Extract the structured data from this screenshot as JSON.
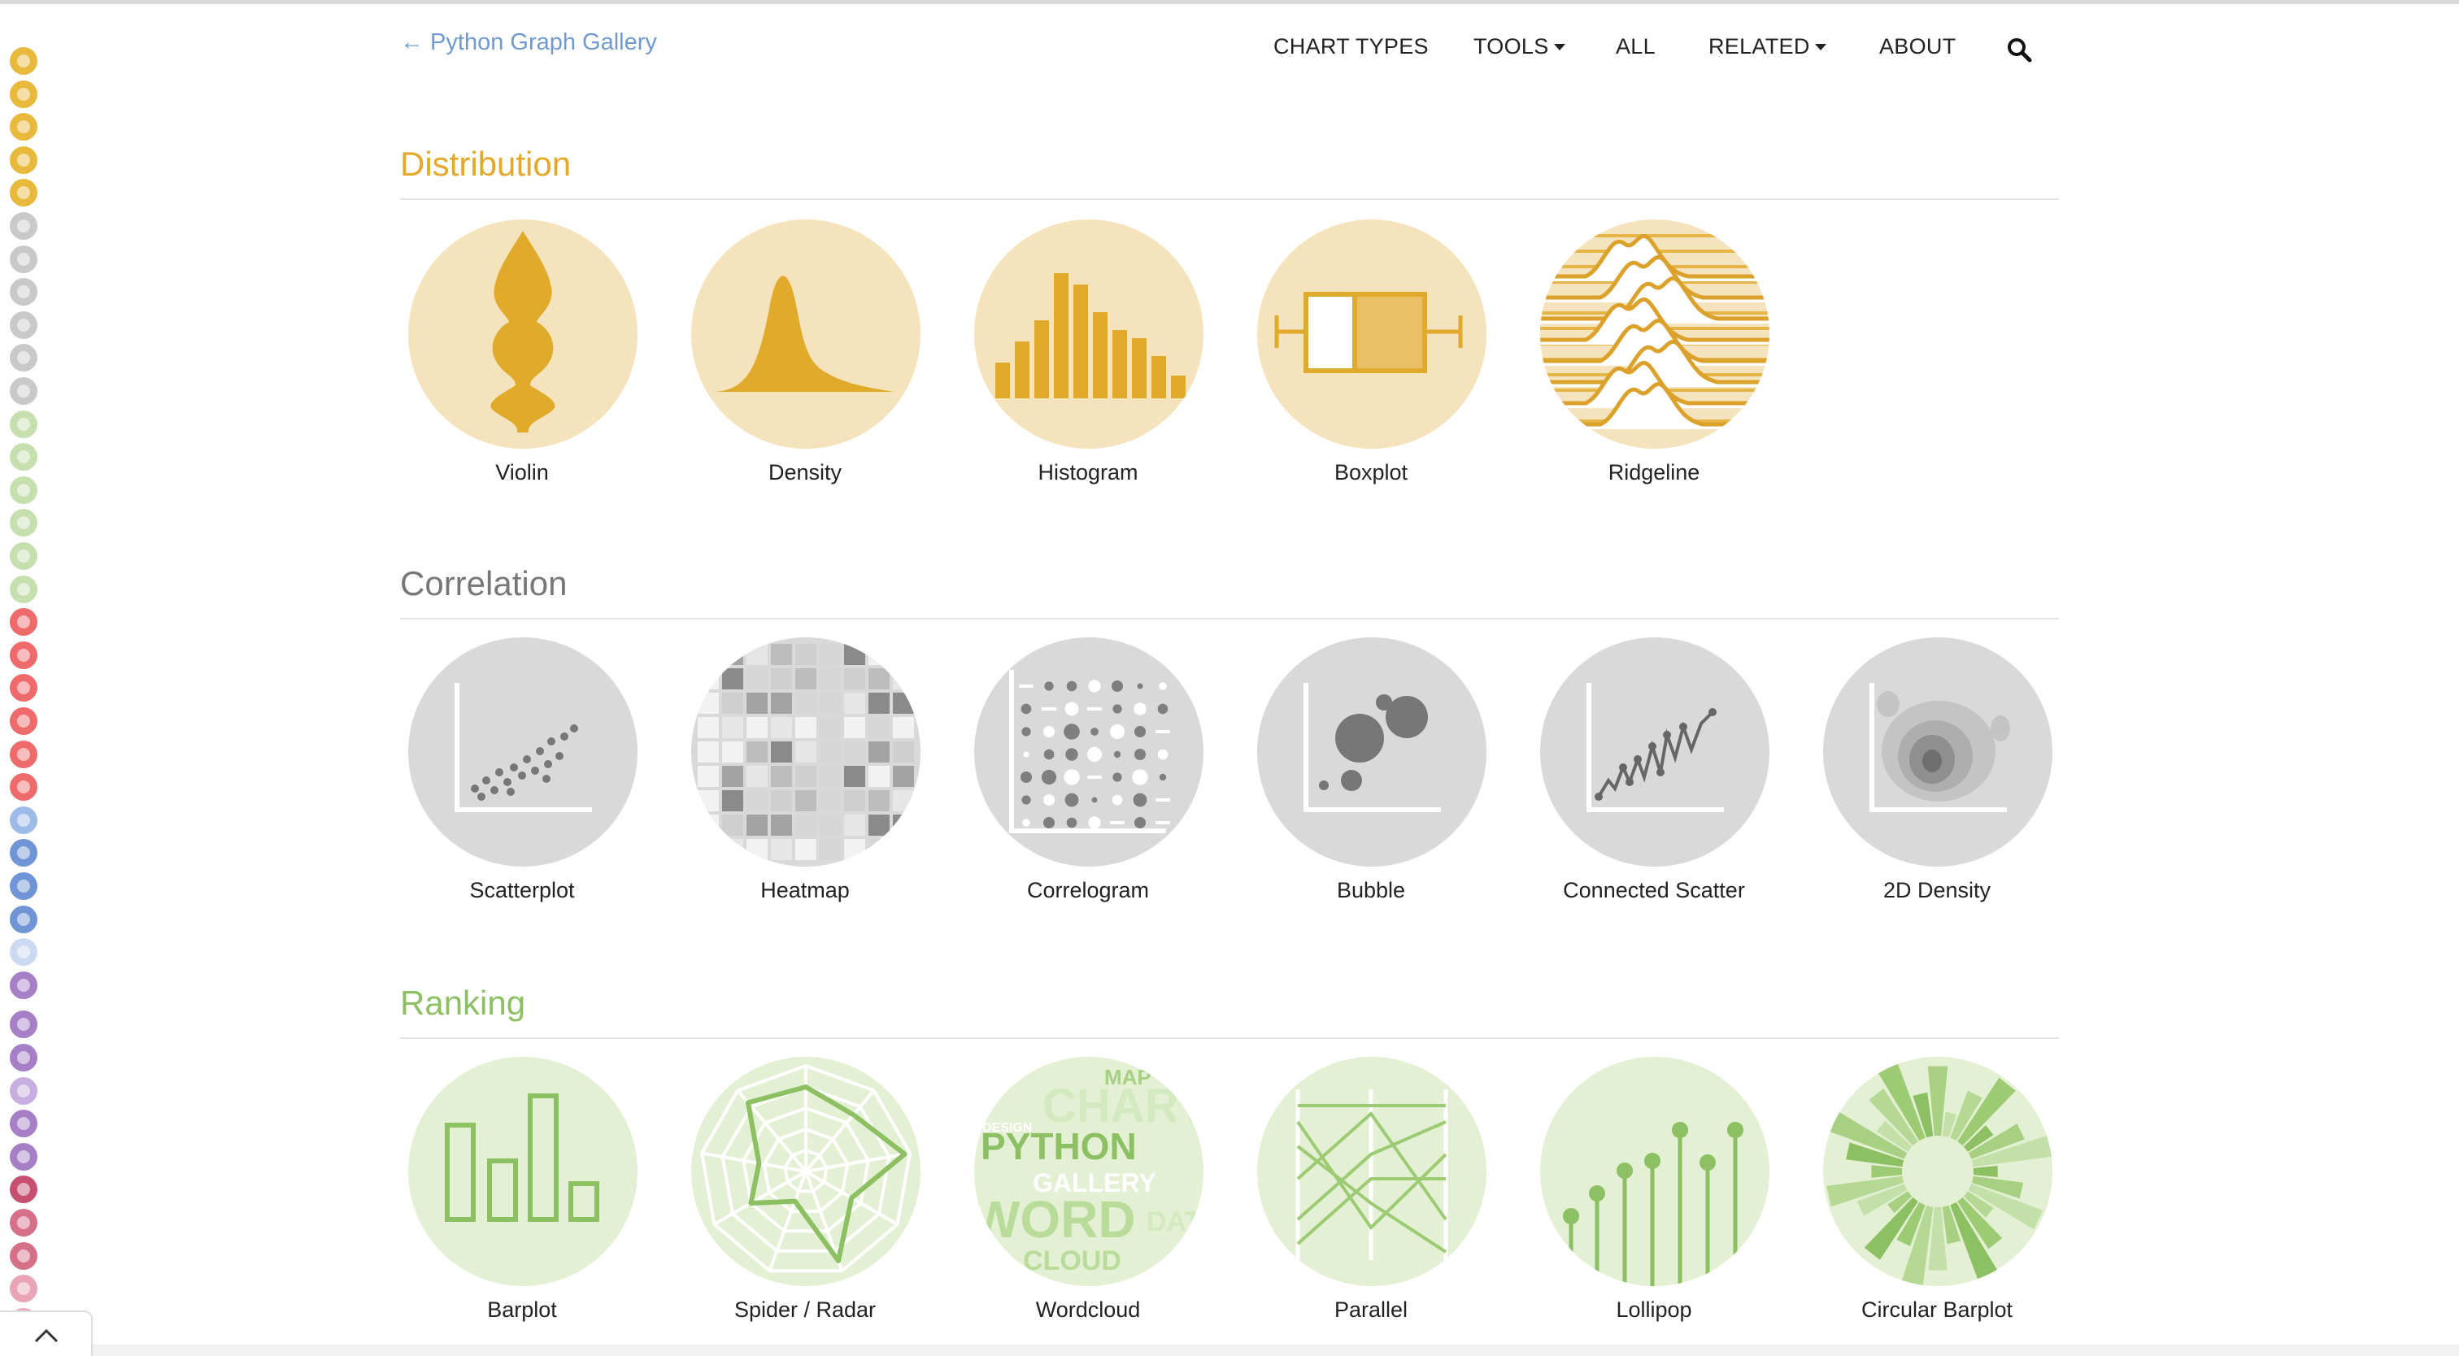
{
  "header": {
    "back_link": "← Python Graph Gallery",
    "nav": [
      {
        "label": "CHART TYPES",
        "dropdown": false
      },
      {
        "label": "TOOLS",
        "dropdown": true
      },
      {
        "label": "ALL",
        "dropdown": false
      },
      {
        "label": "RELATED",
        "dropdown": true
      },
      {
        "label": "ABOUT",
        "dropdown": false
      }
    ],
    "search_icon": "search-icon"
  },
  "rail": {
    "colors": [
      "#e9b93c",
      "#e9b93c",
      "#e9b93c",
      "#e9b93c",
      "#e9b93c",
      "#c9c9c9",
      "#c9c9c9",
      "#c9c9c9",
      "#c9c9c9",
      "#c9c9c9",
      "#c9c9c9",
      "#c5dfae",
      "#c5dfae",
      "#c5dfae",
      "#c5dfae",
      "#c5dfae",
      "#c5dfae",
      "#ef6b6b",
      "#ef6b6b",
      "#ef6b6b",
      "#ef6b6b",
      "#ef6b6b",
      "#ef6b6b",
      "#9dbbe8",
      "#6f95d6",
      "#6f95d6",
      "#6f95d6",
      "#cbd9f1",
      "#a77fc7",
      "#a77fc7",
      "#a77fc7",
      "#c7aee0",
      "#a77fc7",
      "#a77fc7",
      "#c6506f",
      "#d67088",
      "#d67088",
      "#e9a5b5",
      "#e9a5b5"
    ]
  },
  "sections": [
    {
      "title": "Distribution",
      "color": "#e4a82a",
      "bg": "#f5e3bd",
      "items": [
        "Violin",
        "Density",
        "Histogram",
        "Boxplot",
        "Ridgeline"
      ]
    },
    {
      "title": "Correlation",
      "color": "#777777",
      "bg": "#d9d9d9",
      "items": [
        "Scatterplot",
        "Heatmap",
        "Correlogram",
        "Bubble",
        "Connected Scatter",
        "2D Density"
      ]
    },
    {
      "title": "Ranking",
      "color": "#8cc063",
      "bg": "#e3f0d3",
      "items": [
        "Barplot",
        "Spider / Radar",
        "Wordcloud",
        "Parallel",
        "Lollipop",
        "Circular Barplot"
      ]
    }
  ],
  "wordcloud_words": [
    "MAP",
    "CHART",
    "PYTHON",
    "GALLERY",
    "WORD",
    "CLOUD",
    "DESIGN",
    "DATA"
  ]
}
